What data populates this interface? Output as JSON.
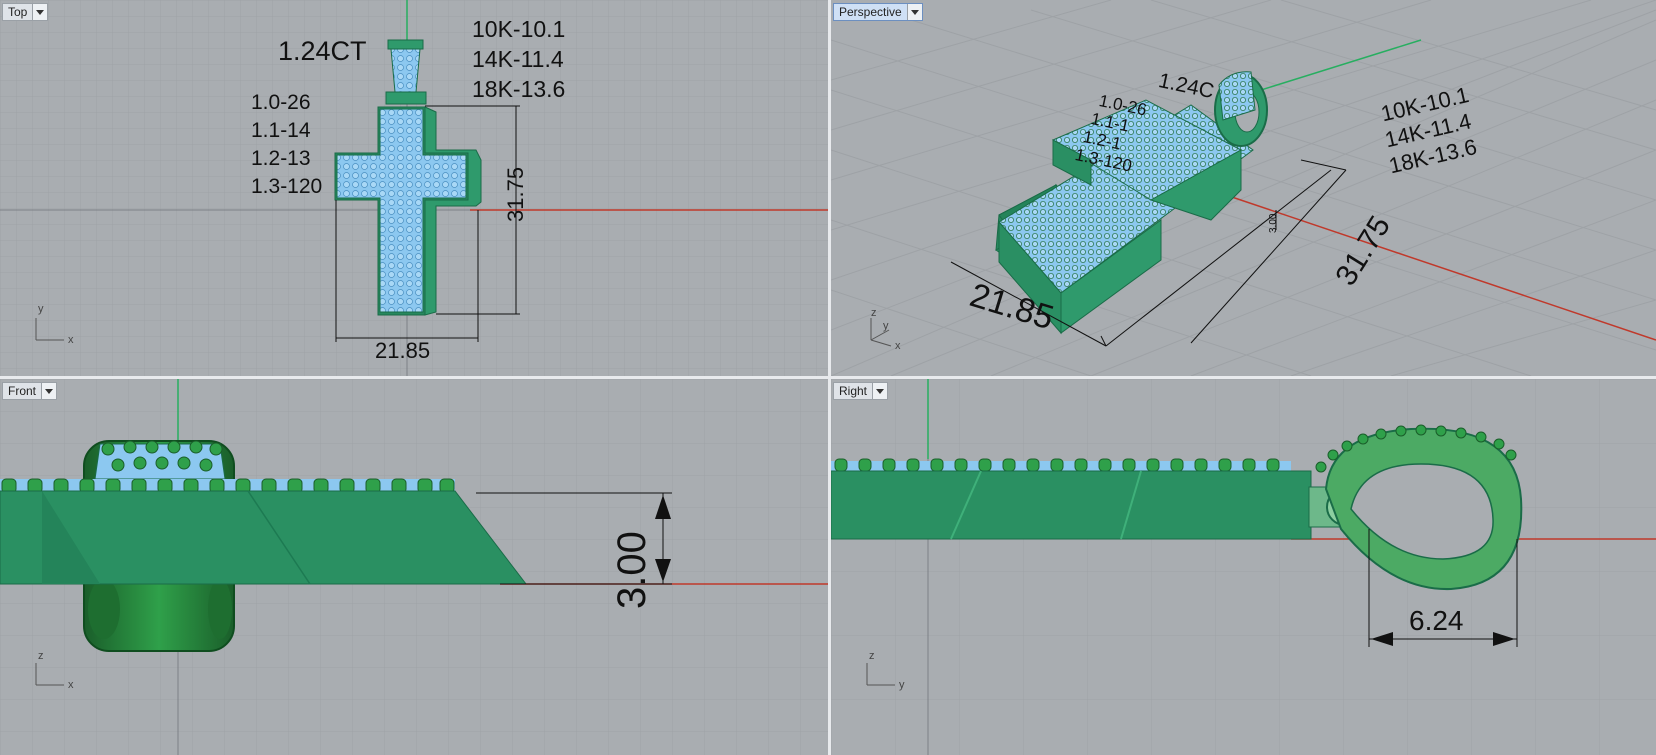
{
  "viewports": {
    "top": {
      "title": "Top",
      "axes": {
        "a": "y",
        "b": "x"
      }
    },
    "perspective": {
      "title": "Perspective",
      "axes": {
        "a": "z",
        "b": "y",
        "c": "x"
      }
    },
    "front": {
      "title": "Front",
      "axes": {
        "a": "z",
        "b": "x"
      }
    },
    "right": {
      "title": "Right",
      "axes": {
        "a": "z",
        "b": "y"
      }
    }
  },
  "annotations": {
    "carat": "1.24CT",
    "carat_persp": "1.24C",
    "metal_weights": [
      "10K-10.1",
      "14K-11.4",
      "18K-13.6"
    ],
    "stone_counts": [
      "1.0-26",
      "1.1-14",
      "1.2-13",
      "1.3-120"
    ],
    "stone_counts_persp": [
      "1.0-26",
      "1.1-1",
      "1.2-1",
      "1.3-120"
    ],
    "width": "21.85",
    "height": "31.75",
    "thickness": "3.00",
    "thickness_small": "3.00",
    "bail_depth": "6.24"
  },
  "colors": {
    "viewport_bg": "#a9adb1",
    "grid": "#9ea2a6",
    "grid_major": "#8f9397",
    "model_green": "#2f9a6c",
    "model_green_dark": "#1f7a52",
    "stones": "#8cc8f0",
    "x_axis": "#c0392b",
    "z_axis": "#27ae60"
  }
}
